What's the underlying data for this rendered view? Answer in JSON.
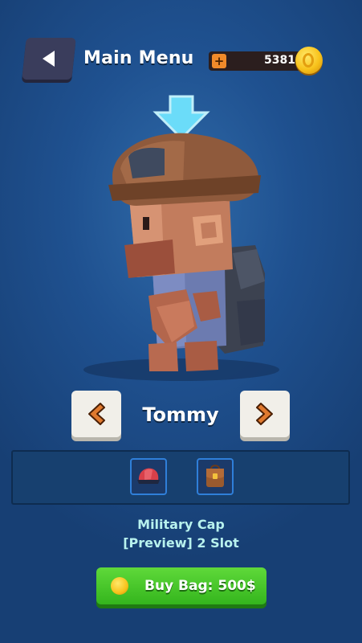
{
  "header": {
    "title": "Main Menu",
    "coins": "5381",
    "plus_symbol": "+"
  },
  "character": {
    "name": "Tommy"
  },
  "items": {
    "slots": [
      {
        "icon": "cap-icon"
      },
      {
        "icon": "bag-icon"
      }
    ],
    "selected_name": "Military Cap",
    "selected_info": "[Preview] 2 Slot"
  },
  "buy": {
    "label": "Buy Bag: 500$"
  },
  "colors": {
    "background": "#1f5190",
    "buy_button": "#45c528",
    "slot_border": "#2f7fd9",
    "item_text": "#b8f2ee"
  }
}
